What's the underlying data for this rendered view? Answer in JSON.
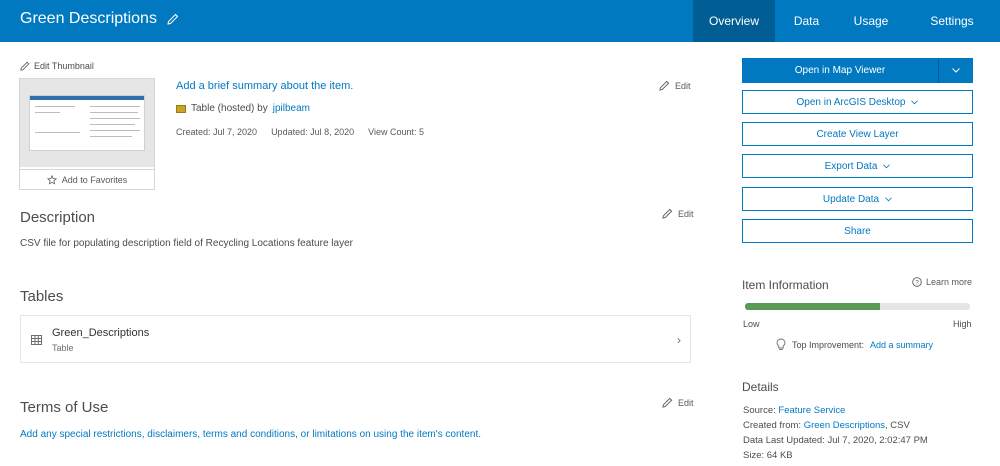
{
  "header": {
    "title": "Green Descriptions",
    "tabs": [
      "Overview",
      "Data",
      "Usage",
      "Settings"
    ]
  },
  "thumbnail": {
    "edit_label": "Edit Thumbnail",
    "favorites_label": "Add to Favorites"
  },
  "summary": {
    "link_text": "Add a brief summary about the item.",
    "type_text": "Table (hosted) by",
    "owner": "jpilbeam",
    "created": "Created: Jul 7, 2020",
    "updated": "Updated: Jul 8, 2020",
    "view_count": "View Count: 5",
    "edit_label": "Edit"
  },
  "description": {
    "heading": "Description",
    "text": "CSV file for populating description field of Recycling Locations feature layer",
    "edit_label": "Edit"
  },
  "tables": {
    "heading": "Tables",
    "items": [
      {
        "name": "Green_Descriptions",
        "type": "Table"
      }
    ]
  },
  "terms": {
    "heading": "Terms of Use",
    "text": "Add any special restrictions, disclaimers, terms and conditions, or limitations on using the item's content.",
    "edit_label": "Edit"
  },
  "actions": {
    "open_map_viewer": "Open in Map Viewer",
    "open_arcgis_desktop": "Open in ArcGIS Desktop",
    "create_view_layer": "Create View Layer",
    "export_data": "Export Data",
    "update_data": "Update Data",
    "share": "Share"
  },
  "item_information": {
    "heading": "Item Information",
    "learn_more": "Learn more",
    "progress_fraction": 0.6,
    "low_label": "Low",
    "high_label": "High",
    "top_improvement_label": "Top Improvement:",
    "top_improvement_link": "Add a summary"
  },
  "details": {
    "heading": "Details",
    "source_label": "Source:",
    "source_value": "Feature Service",
    "created_from_label": "Created from:",
    "created_from_link": "Green Descriptions",
    "created_from_suffix": ", CSV",
    "data_updated": "Data Last Updated: Jul 7, 2020, 2:02:47 PM",
    "size_label": "Size:",
    "size_value": "64 KB"
  },
  "colors": {
    "brand": "#0079c1",
    "brand_dark": "#005e95",
    "progress_fill": "#5a9a54"
  }
}
